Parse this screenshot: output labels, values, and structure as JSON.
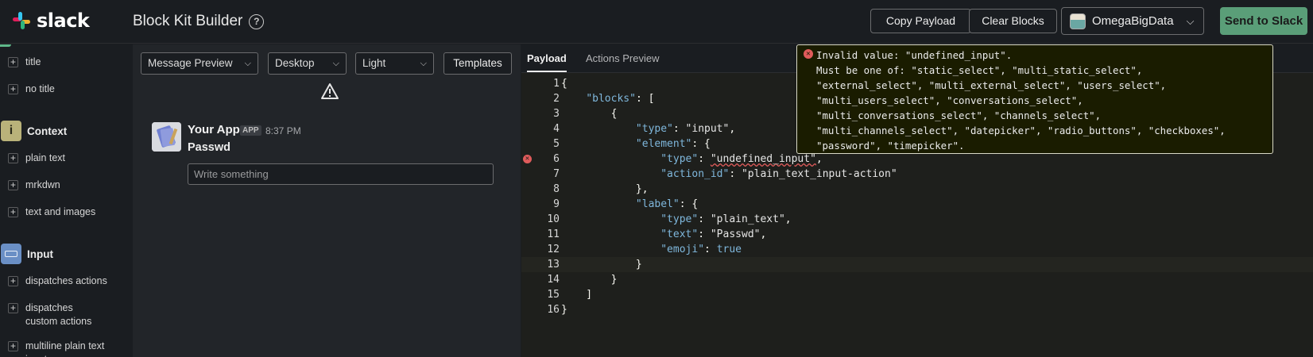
{
  "header": {
    "logo_text": "slack",
    "title": "Block Kit Builder",
    "help_icon": "?",
    "copy_label": "Copy Payload",
    "clear_label": "Clear Blocks",
    "workspace_name": "OmegaBigData",
    "send_label": "Send to Slack"
  },
  "sidebar": {
    "items_top": [
      "title",
      "no title"
    ],
    "context": {
      "label": "Context",
      "icon_letter": "i",
      "color": "#b9b27a",
      "items": [
        "plain text",
        "mrkdwn",
        "text and images"
      ]
    },
    "input": {
      "label": "Input",
      "color": "#6a8fc5",
      "items": [
        "dispatches actions",
        "dispatches custom actions",
        "multiline plain text input"
      ]
    }
  },
  "preview": {
    "view_select": "Message Preview",
    "device_select": "Desktop",
    "theme_select": "Light",
    "templates_label": "Templates",
    "app_name": "Your App",
    "app_badge": "APP",
    "time": "8:37 PM",
    "input_label": "Passwd",
    "input_placeholder": "Write something"
  },
  "editor": {
    "tabs": [
      "Payload",
      "Actions Preview"
    ],
    "error_line": 6,
    "active_line": 13
  },
  "tooltip": {
    "lines": [
      "Invalid value: \"undefined_input\".",
      "Must be one of: \"static_select\", \"multi_static_select\",",
      "\"external_select\", \"multi_external_select\", \"users_select\",",
      "\"multi_users_select\", \"conversations_select\",",
      "\"multi_conversations_select\", \"channels_select\",",
      "\"multi_channels_select\", \"datepicker\", \"radio_buttons\", \"checkboxes\",",
      "\"password\", \"timepicker\"."
    ]
  },
  "colors": {
    "send_button": "#5a9e78",
    "error": "#e05b5b",
    "keyword": "#7fb7dc"
  }
}
